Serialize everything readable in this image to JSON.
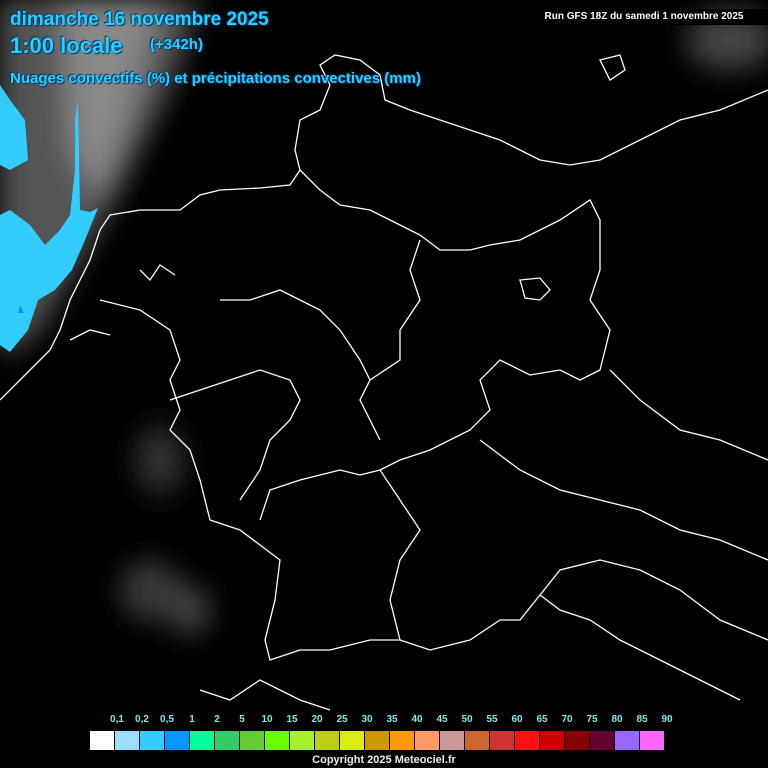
{
  "header": {
    "date": "dimanche 16 novembre 2025",
    "time": "1:00 locale",
    "lead": "(+342h)",
    "parameter": "Nuages convectifs (%) et précipitations convectives (mm)",
    "run": "Run GFS 18Z du samedi 1 novembre 2025"
  },
  "legend": {
    "labels": [
      "0,1",
      "0,2",
      "0,5",
      "1",
      "2",
      "5",
      "10",
      "15",
      "20",
      "25",
      "30",
      "35",
      "40",
      "45",
      "50",
      "55",
      "60",
      "65",
      "70",
      "75",
      "80",
      "85",
      "90"
    ],
    "colors": [
      "#ffffff",
      "#99e0ff",
      "#33ccff",
      "#0099ff",
      "#00ff99",
      "#33cc66",
      "#66cc33",
      "#66ff00",
      "#a6f02f",
      "#bfcc14",
      "#d9ed14",
      "#cc9900",
      "#ff9900",
      "#ff9966",
      "#cc9999",
      "#cc6633",
      "#cc3333",
      "#ff1111",
      "#cc0000",
      "#880000",
      "#660033",
      "#9966ff",
      "#ff66ff"
    ]
  },
  "copyright": "Copyright 2025 Meteociel.fr"
}
